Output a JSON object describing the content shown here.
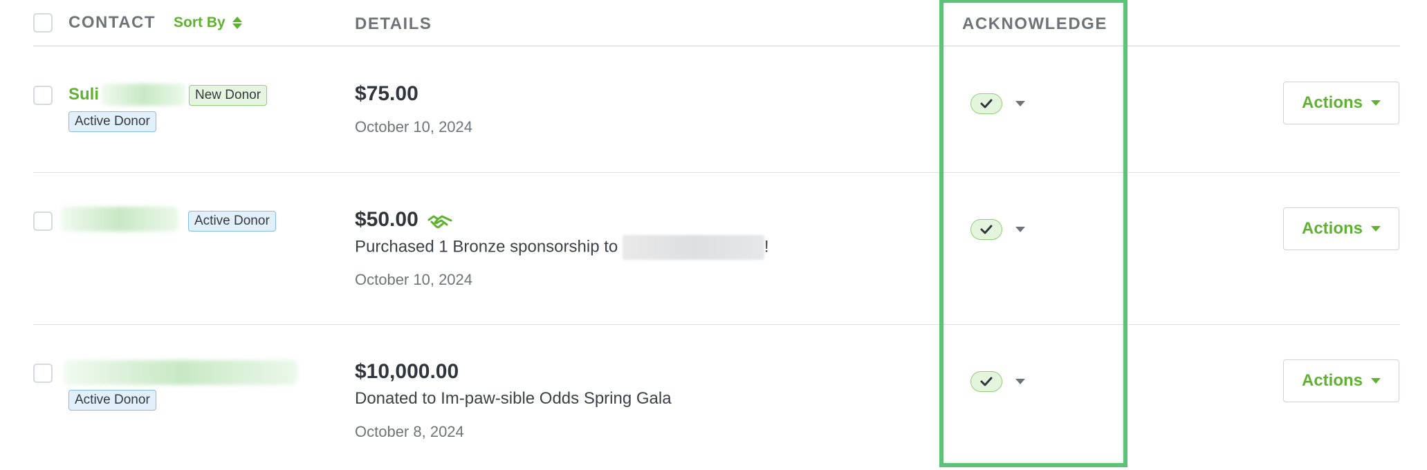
{
  "header": {
    "contact_label": "CONTACT",
    "sort_label": "Sort By",
    "details_label": "DETAILS",
    "acknowledge_label": "ACKNOWLEDGE"
  },
  "colors": {
    "accent_green": "#5fb130",
    "highlight_green": "#5cc27a",
    "active_badge_blue": "#e1f0fb",
    "new_badge_green": "#e6f5df"
  },
  "rows": [
    {
      "contact_name_visible": "Suli",
      "badges": [
        "New Donor",
        "Active Donor"
      ],
      "amount": "$75.00",
      "description": "",
      "date": "October 10, 2024",
      "acknowledged": true,
      "actions_label": "Actions"
    },
    {
      "contact_name_visible": "",
      "badges": [
        "Active Donor"
      ],
      "amount": "$50.00",
      "icon": "handshake-icon",
      "description_prefix": "Purchased 1 Bronze sponsorship to",
      "description_suffix": "!",
      "date": "October 10, 2024",
      "acknowledged": true,
      "actions_label": "Actions"
    },
    {
      "contact_name_visible": "",
      "badges": [
        "Active Donor"
      ],
      "amount": "$10,000.00",
      "description": "Donated to Im-paw-sible Odds Spring Gala",
      "date": "October 8, 2024",
      "acknowledged": true,
      "actions_label": "Actions"
    }
  ]
}
